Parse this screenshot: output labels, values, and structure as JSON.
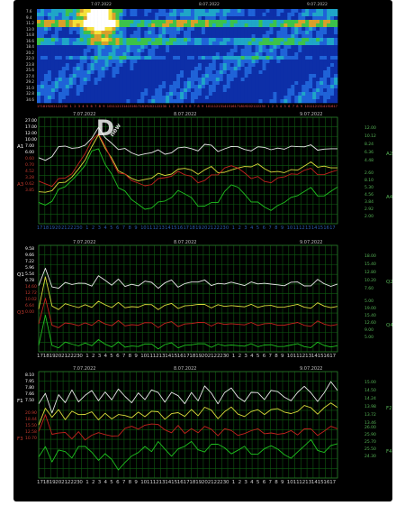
{
  "colors": {
    "background": "#000000",
    "grid": "#0f5a12",
    "white_series": "#e6e6e6",
    "yellow_series": "#d9d93a",
    "red_series": "#c4221e",
    "green_series": "#1fc11f",
    "axis_green": "#57b657",
    "axis_red": "#c33a2e",
    "hour_labels": "#2cb0e0"
  },
  "watermark_logo": "new",
  "spectrogram": {
    "dates": [
      "7.07.2022",
      "8.07.2022",
      "9.07.2022"
    ],
    "y_ticks": [
      "7.6",
      "9.4",
      "11.2",
      "13.0",
      "14.8",
      "16.6",
      "18.4",
      "20.2",
      "22.0",
      "23.8",
      "25.6",
      "27.4",
      "29.2",
      "31.0",
      "32.8",
      "34.6"
    ],
    "hour_ticks": [
      "17",
      "18",
      "19",
      "20",
      "21",
      "22",
      "23",
      "0",
      "1",
      "2",
      "3",
      "4",
      "5",
      "6",
      "7",
      "8",
      "9",
      "10",
      "11",
      "12",
      "13",
      "14",
      "15",
      "16",
      "17",
      "18",
      "19",
      "20",
      "21",
      "22",
      "23",
      "0",
      "1",
      "2",
      "3",
      "4",
      "5",
      "6",
      "7",
      "8",
      "9",
      "10",
      "11",
      "12",
      "13",
      "14",
      "15",
      "16",
      "17",
      "18",
      "19",
      "20",
      "21",
      "22",
      "23",
      "0",
      "1",
      "2",
      "3",
      "4",
      "5",
      "6",
      "7",
      "8",
      "9",
      "10",
      "11",
      "12",
      "13",
      "14",
      "15",
      "16",
      "17"
    ],
    "unit": "UTC"
  },
  "chart_data": [
    {
      "type": "line",
      "panel": "A",
      "dates": [
        "7.07.2022",
        "8.07.2022",
        "9.07.2022"
      ],
      "left_scale_top": [
        "27.00",
        "17.00",
        "12.00",
        "10.00",
        "7.00",
        "6.00"
      ],
      "left_scale_bottom": [
        "0.60",
        "0.70",
        "4.52",
        "3.28",
        "0.62",
        "3.85"
      ],
      "right_scale_top": [
        "12.00",
        "10.12",
        "8.24",
        "6.36",
        "4.48"
      ],
      "right_scale_bottom": [
        "2.60",
        "8.10",
        "5.30",
        "4.56",
        "3.84",
        "2.92",
        "2.00"
      ],
      "axis_labels": {
        "left_top": "A1",
        "left_bottom": "A3",
        "right_top": "A2",
        "right_bottom": "A4"
      },
      "hour_ticks": [
        "17",
        "18",
        "19",
        "20",
        "21",
        "22",
        "23",
        "0",
        "1",
        "2",
        "3",
        "4",
        "5",
        "6",
        "7",
        "8",
        "9",
        "10",
        "11",
        "12",
        "13",
        "14",
        "15",
        "16",
        "17",
        "18",
        "19",
        "20",
        "21",
        "22",
        "23",
        "0",
        "1",
        "2",
        "3",
        "4",
        "5",
        "6",
        "7",
        "8",
        "9",
        "10",
        "11",
        "12",
        "13",
        "14",
        "15",
        "16",
        "17"
      ],
      "series": [
        {
          "color": "white",
          "values": [
            0.62,
            0.6,
            0.64,
            0.7,
            0.74,
            0.72,
            0.7,
            0.74,
            0.8,
            0.92,
            0.8,
            0.74,
            0.72,
            0.7,
            0.66,
            0.64,
            0.66,
            0.68,
            0.67,
            0.66,
            0.68,
            0.7,
            0.72,
            0.7,
            0.7,
            0.74,
            0.72,
            0.7,
            0.7,
            0.72,
            0.72,
            0.7,
            0.7,
            0.7,
            0.72,
            0.71,
            0.7,
            0.7,
            0.72,
            0.74,
            0.72,
            0.72,
            0.71,
            0.7,
            0.7,
            0.7
          ]
        },
        {
          "color": "yellow",
          "values": [
            0.3,
            0.3,
            0.32,
            0.36,
            0.4,
            0.45,
            0.5,
            0.6,
            0.72,
            0.85,
            0.7,
            0.6,
            0.52,
            0.46,
            0.42,
            0.4,
            0.42,
            0.44,
            0.45,
            0.46,
            0.48,
            0.5,
            0.52,
            0.5,
            0.48,
            0.5,
            0.52,
            0.5,
            0.48,
            0.5,
            0.52,
            0.54,
            0.55,
            0.54,
            0.52,
            0.5,
            0.48,
            0.48,
            0.5,
            0.52,
            0.54,
            0.56,
            0.55,
            0.54,
            0.52,
            0.52
          ]
        },
        {
          "color": "red",
          "values": [
            0.4,
            0.38,
            0.36,
            0.4,
            0.44,
            0.48,
            0.55,
            0.66,
            0.78,
            0.86,
            0.72,
            0.58,
            0.5,
            0.46,
            0.4,
            0.38,
            0.36,
            0.38,
            0.4,
            0.44,
            0.46,
            0.48,
            0.46,
            0.44,
            0.4,
            0.4,
            0.44,
            0.48,
            0.52,
            0.54,
            0.52,
            0.48,
            0.44,
            0.42,
            0.4,
            0.4,
            0.42,
            0.44,
            0.46,
            0.48,
            0.5,
            0.5,
            0.48,
            0.46,
            0.48,
            0.5
          ]
        },
        {
          "color": "green",
          "values": [
            0.2,
            0.18,
            0.22,
            0.3,
            0.36,
            0.42,
            0.46,
            0.55,
            0.68,
            0.72,
            0.55,
            0.45,
            0.36,
            0.3,
            0.22,
            0.18,
            0.14,
            0.16,
            0.18,
            0.22,
            0.26,
            0.3,
            0.28,
            0.24,
            0.18,
            0.16,
            0.18,
            0.22,
            0.3,
            0.36,
            0.34,
            0.28,
            0.22,
            0.18,
            0.16,
            0.14,
            0.16,
            0.2,
            0.24,
            0.28,
            0.3,
            0.32,
            0.28,
            0.26,
            0.3,
            0.34
          ]
        }
      ]
    },
    {
      "type": "line",
      "panel": "Q",
      "dates": [
        "7.07.2022",
        "8.07.2022",
        "9.07.2022"
      ],
      "left_scale_top": [
        "9.58",
        "9.66",
        "7.22",
        "5.96",
        "5.54",
        "6.78"
      ],
      "left_scale_bottom": [
        "14.60",
        "12.72",
        "10.02",
        "6.64",
        "0.00"
      ],
      "right_scale_top": [
        "18.00",
        "15.40",
        "12.80",
        "10.20",
        "7.60"
      ],
      "right_scale_bottom": [
        "5.00",
        "19.00",
        "15.40",
        "12.60",
        "9.00",
        "5.00"
      ],
      "axis_labels": {
        "left_top": "Q1",
        "left_bottom": "Q3",
        "right_top": "Q2",
        "right_bottom": "Q4"
      },
      "hour_ticks": [
        "17",
        "18",
        "19",
        "20",
        "21",
        "22",
        "23",
        "0",
        "1",
        "2",
        "3",
        "4",
        "5",
        "6",
        "7",
        "8",
        "9",
        "10",
        "11",
        "12",
        "13",
        "14",
        "15",
        "16",
        "17",
        "18",
        "19",
        "20",
        "21",
        "22",
        "23",
        "0",
        "1",
        "2",
        "3",
        "4",
        "5",
        "6",
        "7",
        "8",
        "9",
        "10",
        "11",
        "12",
        "13",
        "14",
        "15",
        "16",
        "17"
      ],
      "series": [
        {
          "color": "white",
          "values": [
            0.62,
            0.78,
            0.6,
            0.62,
            0.64,
            0.62,
            0.66,
            0.64,
            0.62,
            0.7,
            0.68,
            0.64,
            0.66,
            0.62,
            0.64,
            0.62,
            0.66,
            0.64,
            0.62,
            0.64,
            0.66,
            0.62,
            0.64,
            0.66,
            0.64,
            0.68,
            0.64,
            0.62,
            0.64,
            0.66,
            0.64,
            0.62,
            0.64,
            0.66,
            0.64,
            0.62,
            0.64,
            0.62,
            0.66,
            0.64,
            0.62,
            0.64,
            0.66,
            0.64,
            0.62,
            0.64
          ]
        },
        {
          "color": "yellow",
          "values": [
            0.4,
            0.7,
            0.42,
            0.42,
            0.44,
            0.42,
            0.43,
            0.44,
            0.42,
            0.46,
            0.45,
            0.43,
            0.44,
            0.42,
            0.43,
            0.42,
            0.44,
            0.43,
            0.42,
            0.43,
            0.44,
            0.42,
            0.43,
            0.44,
            0.43,
            0.45,
            0.43,
            0.42,
            0.43,
            0.44,
            0.43,
            0.42,
            0.43,
            0.44,
            0.43,
            0.42,
            0.43,
            0.42,
            0.44,
            0.43,
            0.42,
            0.43,
            0.44,
            0.43,
            0.42,
            0.43
          ]
        },
        {
          "color": "red",
          "values": [
            0.26,
            0.5,
            0.24,
            0.25,
            0.26,
            0.25,
            0.26,
            0.27,
            0.25,
            0.28,
            0.27,
            0.26,
            0.27,
            0.25,
            0.26,
            0.25,
            0.27,
            0.26,
            0.25,
            0.26,
            0.27,
            0.25,
            0.26,
            0.27,
            0.26,
            0.28,
            0.26,
            0.25,
            0.26,
            0.27,
            0.26,
            0.25,
            0.26,
            0.27,
            0.26,
            0.25,
            0.26,
            0.25,
            0.27,
            0.26,
            0.25,
            0.26,
            0.27,
            0.26,
            0.25,
            0.26
          ]
        },
        {
          "color": "green",
          "values": [
            0.06,
            0.34,
            0.05,
            0.06,
            0.08,
            0.06,
            0.07,
            0.08,
            0.06,
            0.1,
            0.08,
            0.06,
            0.07,
            0.05,
            0.06,
            0.05,
            0.07,
            0.06,
            0.05,
            0.06,
            0.07,
            0.05,
            0.06,
            0.07,
            0.06,
            0.08,
            0.06,
            0.05,
            0.06,
            0.07,
            0.06,
            0.05,
            0.06,
            0.07,
            0.06,
            0.05,
            0.06,
            0.05,
            0.07,
            0.06,
            0.05,
            0.06,
            0.07,
            0.06,
            0.05,
            0.06
          ]
        }
      ]
    },
    {
      "type": "line",
      "panel": "F",
      "dates": [
        "7.07.2022",
        "8.07.2022",
        "9.07.2022"
      ],
      "left_scale_top": [
        "8.10",
        "7.95",
        "7.80",
        "7.66",
        "7.50"
      ],
      "left_scale_bottom": [
        "20.90",
        "18.44",
        "15.50",
        "12.58",
        "10.70"
      ],
      "right_scale_top": [
        "15.00",
        "14.50",
        "14.24",
        "13.98",
        "13.72",
        "13.46"
      ],
      "right_scale_bottom": [
        "26.00",
        "25.90",
        "25.70",
        "25.50",
        "24.30"
      ],
      "axis_labels": {
        "left_top": "F1",
        "left_bottom": "F3",
        "right_top": "F2",
        "right_bottom": "F4"
      },
      "hour_ticks": [
        "17",
        "18",
        "19",
        "20",
        "21",
        "22",
        "23",
        "0",
        "1",
        "2",
        "3",
        "4",
        "5",
        "6",
        "7",
        "8",
        "9",
        "10",
        "11",
        "12",
        "13",
        "14",
        "15",
        "16",
        "17",
        "18",
        "19",
        "20",
        "21",
        "22",
        "23",
        "0",
        "1",
        "2",
        "3",
        "4",
        "5",
        "6",
        "7",
        "8",
        "9",
        "10",
        "11",
        "12",
        "13",
        "14",
        "15",
        "16",
        "17"
      ],
      "series": [
        {
          "color": "white",
          "values": [
            0.7,
            0.8,
            0.62,
            0.76,
            0.72,
            0.84,
            0.7,
            0.78,
            0.82,
            0.74,
            0.8,
            0.72,
            0.86,
            0.76,
            0.7,
            0.8,
            0.74,
            0.84,
            0.78,
            0.72,
            0.82,
            0.76,
            0.7,
            0.8,
            0.74,
            0.86,
            0.78,
            0.72,
            0.8,
            0.84,
            0.76,
            0.72,
            0.82,
            0.78,
            0.74,
            0.84,
            0.8,
            0.76,
            0.72,
            0.82,
            0.86,
            0.78,
            0.74,
            0.8,
            0.9,
            0.82
          ]
        },
        {
          "color": "yellow",
          "values": [
            0.5,
            0.66,
            0.58,
            0.62,
            0.56,
            0.64,
            0.58,
            0.6,
            0.62,
            0.56,
            0.6,
            0.54,
            0.62,
            0.58,
            0.56,
            0.62,
            0.58,
            0.64,
            0.6,
            0.56,
            0.62,
            0.6,
            0.58,
            0.64,
            0.6,
            0.66,
            0.62,
            0.58,
            0.62,
            0.66,
            0.6,
            0.58,
            0.64,
            0.62,
            0.6,
            0.66,
            0.64,
            0.62,
            0.6,
            0.64,
            0.68,
            0.64,
            0.62,
            0.66,
            0.7,
            0.66
          ]
        },
        {
          "color": "red",
          "values": [
            0.44,
            0.6,
            0.42,
            0.4,
            0.44,
            0.38,
            0.42,
            0.36,
            0.4,
            0.44,
            0.4,
            0.38,
            0.42,
            0.46,
            0.48,
            0.46,
            0.5,
            0.52,
            0.48,
            0.46,
            0.44,
            0.48,
            0.42,
            0.46,
            0.44,
            0.48,
            0.44,
            0.42,
            0.46,
            0.44,
            0.4,
            0.42,
            0.46,
            0.44,
            0.42,
            0.44,
            0.4,
            0.42,
            0.44,
            0.42,
            0.46,
            0.44,
            0.42,
            0.44,
            0.48,
            0.46
          ]
        },
        {
          "color": "green",
          "values": [
            0.2,
            0.3,
            0.16,
            0.24,
            0.26,
            0.2,
            0.28,
            0.3,
            0.24,
            0.18,
            0.22,
            0.16,
            0.1,
            0.14,
            0.2,
            0.24,
            0.3,
            0.26,
            0.32,
            0.28,
            0.22,
            0.26,
            0.3,
            0.34,
            0.28,
            0.24,
            0.3,
            0.34,
            0.28,
            0.22,
            0.26,
            0.3,
            0.24,
            0.2,
            0.28,
            0.32,
            0.26,
            0.22,
            0.18,
            0.26,
            0.3,
            0.34,
            0.28,
            0.24,
            0.3,
            0.32
          ]
        }
      ]
    }
  ]
}
